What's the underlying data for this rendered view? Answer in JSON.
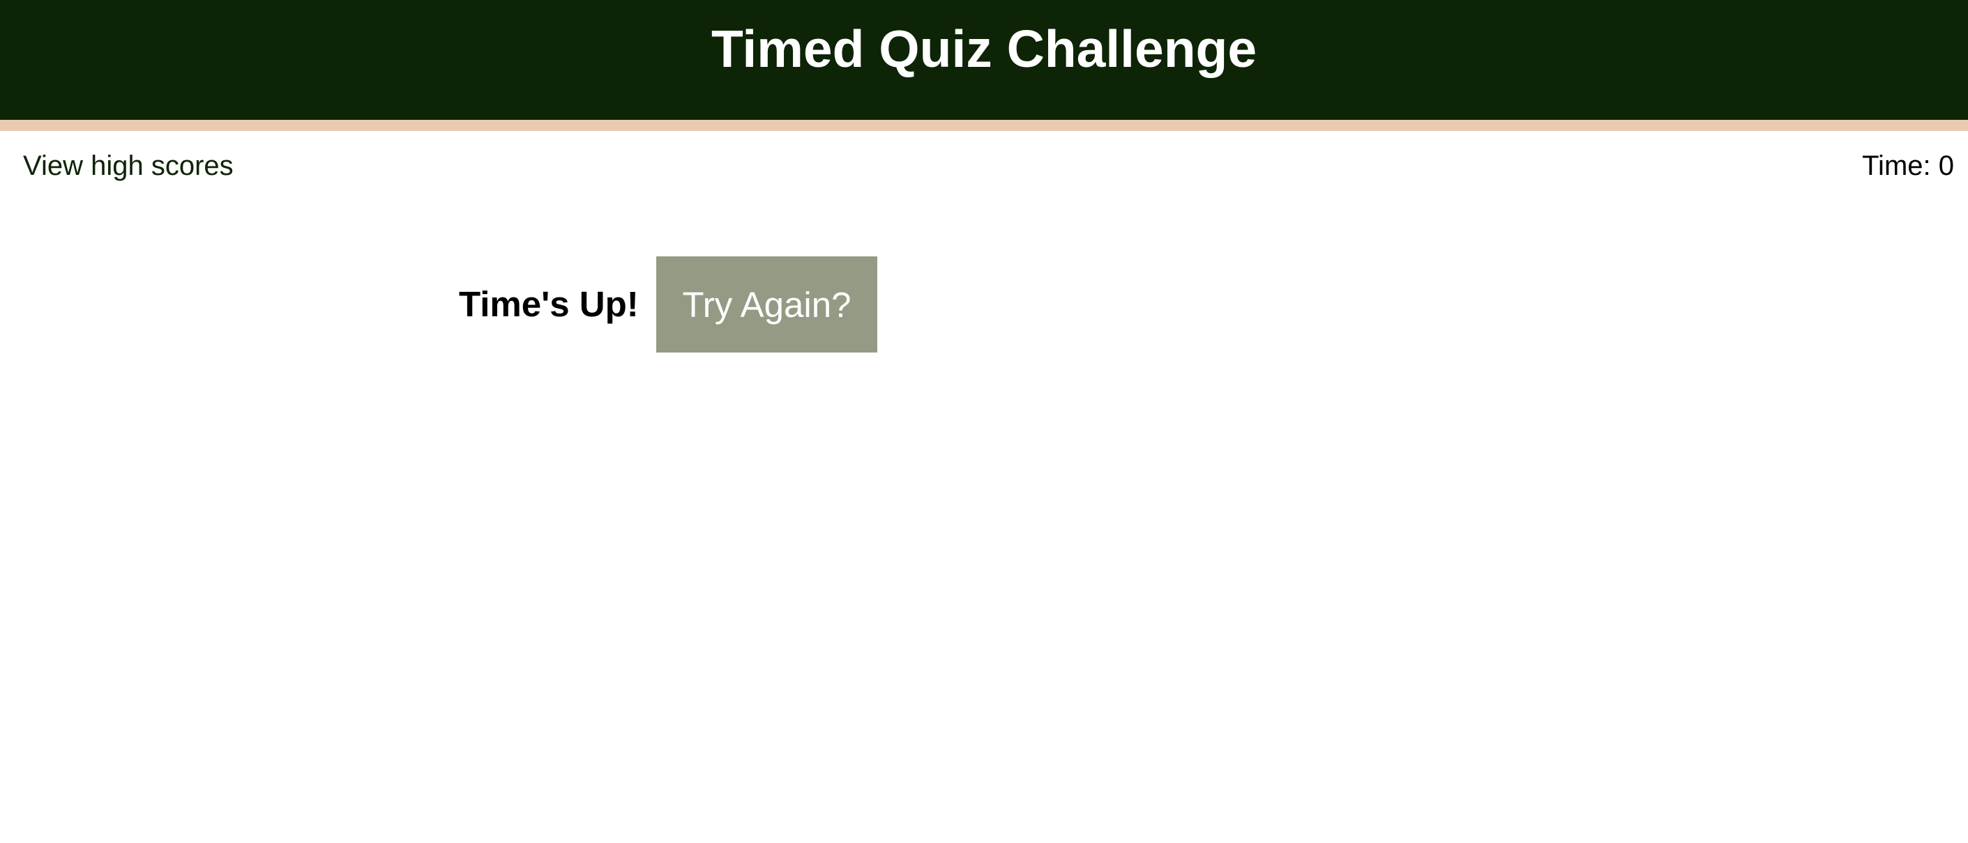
{
  "header": {
    "title": "Timed Quiz Challenge"
  },
  "nav": {
    "high_scores_label": "View high scores"
  },
  "timer": {
    "label": "Time: ",
    "value": "0"
  },
  "result": {
    "message": "Time's Up!",
    "retry_label": "Try Again?"
  },
  "colors": {
    "header_background": "#0d2406",
    "accent_bar": "#e8cbb0",
    "button_background": "#949b85"
  }
}
